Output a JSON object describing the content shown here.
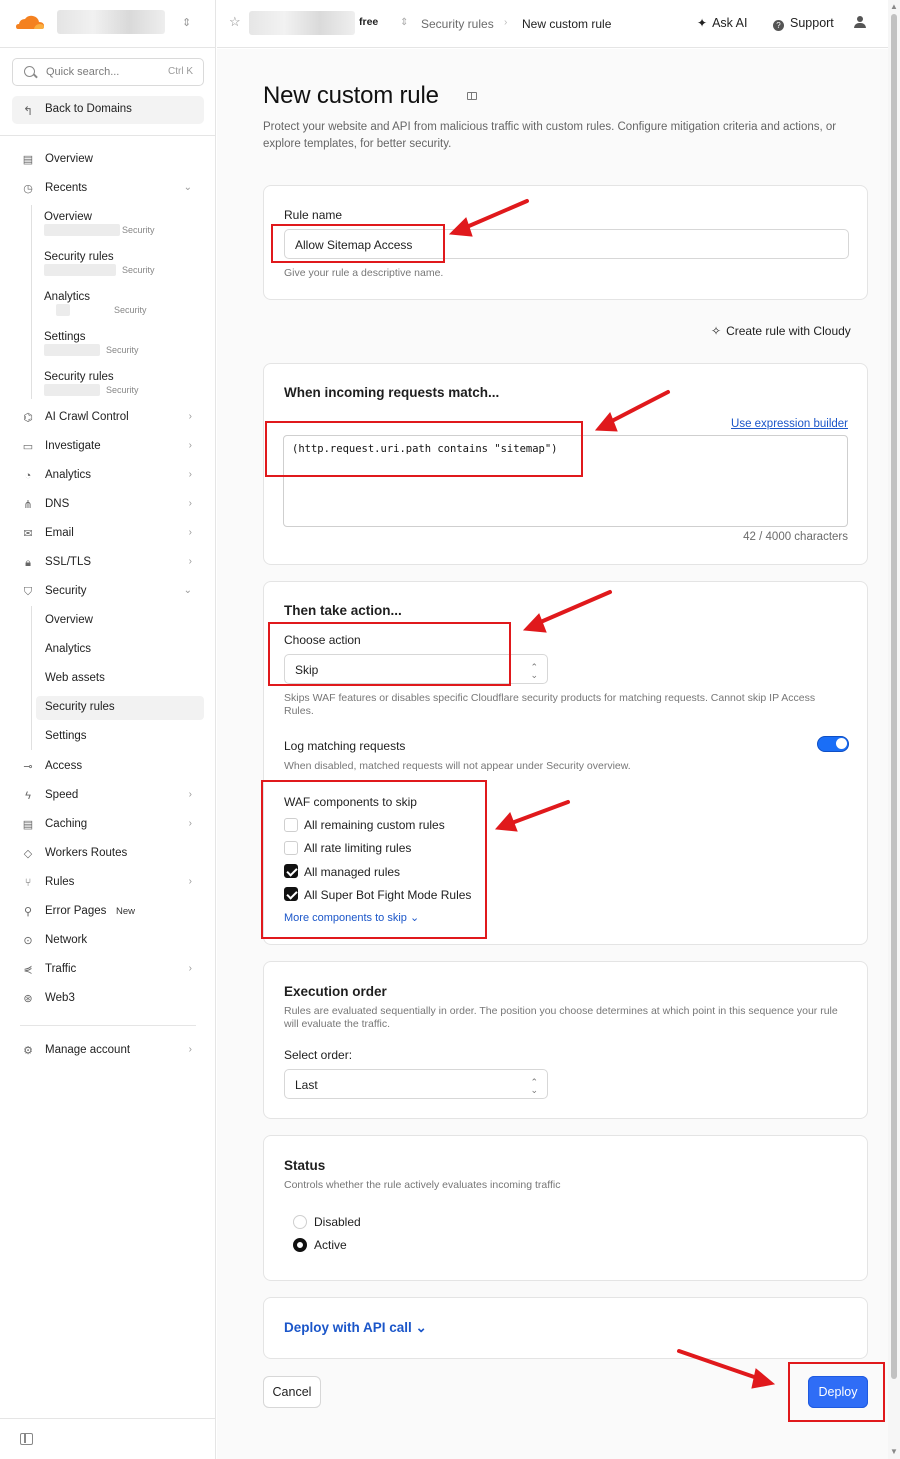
{
  "sidebar": {
    "search_placeholder": "Quick search...",
    "search_shortcut": "Ctrl K",
    "back_label": "Back to Domains",
    "overview": "Overview",
    "recents_label": "Recents",
    "recents": [
      {
        "title": "Overview",
        "section": "Security"
      },
      {
        "title": "Security rules",
        "section": "Security"
      },
      {
        "title": "Analytics",
        "section": "Security"
      },
      {
        "title": "Settings",
        "section": "Security"
      },
      {
        "title": "Security rules",
        "section": "Security"
      }
    ],
    "items_a": [
      {
        "label": "AI Crawl Control"
      },
      {
        "label": "Investigate"
      },
      {
        "label": "Analytics"
      },
      {
        "label": "DNS"
      },
      {
        "label": "Email"
      },
      {
        "label": "SSL/TLS"
      },
      {
        "label": "Security"
      }
    ],
    "security_sub": [
      "Overview",
      "Analytics",
      "Web assets",
      "Security rules",
      "Settings"
    ],
    "items_b": [
      {
        "label": "Access"
      },
      {
        "label": "Speed"
      },
      {
        "label": "Caching"
      },
      {
        "label": "Workers Routes"
      },
      {
        "label": "Rules"
      },
      {
        "label": "Error Pages",
        "badge": "New"
      },
      {
        "label": "Network"
      },
      {
        "label": "Traffic"
      },
      {
        "label": "Web3"
      }
    ],
    "manage_account": "Manage account"
  },
  "topbar": {
    "plan": "free",
    "breadcrumb_1": "Security rules",
    "breadcrumb_2": "New custom rule",
    "ask_ai": "Ask AI",
    "support": "Support"
  },
  "page": {
    "title": "New custom rule",
    "description": "Protect your website and API from malicious traffic with custom rules. Configure mitigation criteria and actions, or explore templates, for better security."
  },
  "rule_name": {
    "label": "Rule name",
    "value": "Allow Sitemap Access",
    "help": "Give your rule a descriptive name."
  },
  "cloudy_label": "Create rule with Cloudy",
  "match": {
    "title": "When incoming requests match...",
    "expression_builder": "Use expression builder",
    "expression": "(http.request.uri.path contains \"sitemap\")",
    "char_count": "42 / 4000 characters"
  },
  "action": {
    "title": "Then take action...",
    "choose_label": "Choose action",
    "selected": "Skip",
    "help": "Skips WAF features or disables specific Cloudflare security products for matching requests. Cannot skip IP Access Rules.",
    "log_label": "Log matching requests",
    "log_help": "When disabled, matched requests will not appear under Security overview.",
    "log_enabled": true,
    "waf_title": "WAF components to skip",
    "components": [
      {
        "label": "All remaining custom rules",
        "checked": false
      },
      {
        "label": "All rate limiting rules",
        "checked": false
      },
      {
        "label": "All managed rules",
        "checked": true
      },
      {
        "label": "All Super Bot Fight Mode Rules",
        "checked": true
      }
    ],
    "more_components": "More components to skip"
  },
  "execution": {
    "title": "Execution order",
    "help": "Rules are evaluated sequentially in order. The position you choose determines at which point in this sequence your rule will evaluate the traffic.",
    "select_label": "Select order:",
    "selected": "Last"
  },
  "status": {
    "title": "Status",
    "help": "Controls whether the rule actively evaluates incoming traffic",
    "options": [
      {
        "label": "Disabled",
        "selected": false
      },
      {
        "label": "Active",
        "selected": true
      }
    ]
  },
  "deploy_api": "Deploy with API call",
  "buttons": {
    "cancel": "Cancel",
    "deploy": "Deploy"
  },
  "colors": {
    "accent": "#2f6df6",
    "link": "#1b56c9",
    "highlight": "#e0191c",
    "brand": "#f48120"
  }
}
